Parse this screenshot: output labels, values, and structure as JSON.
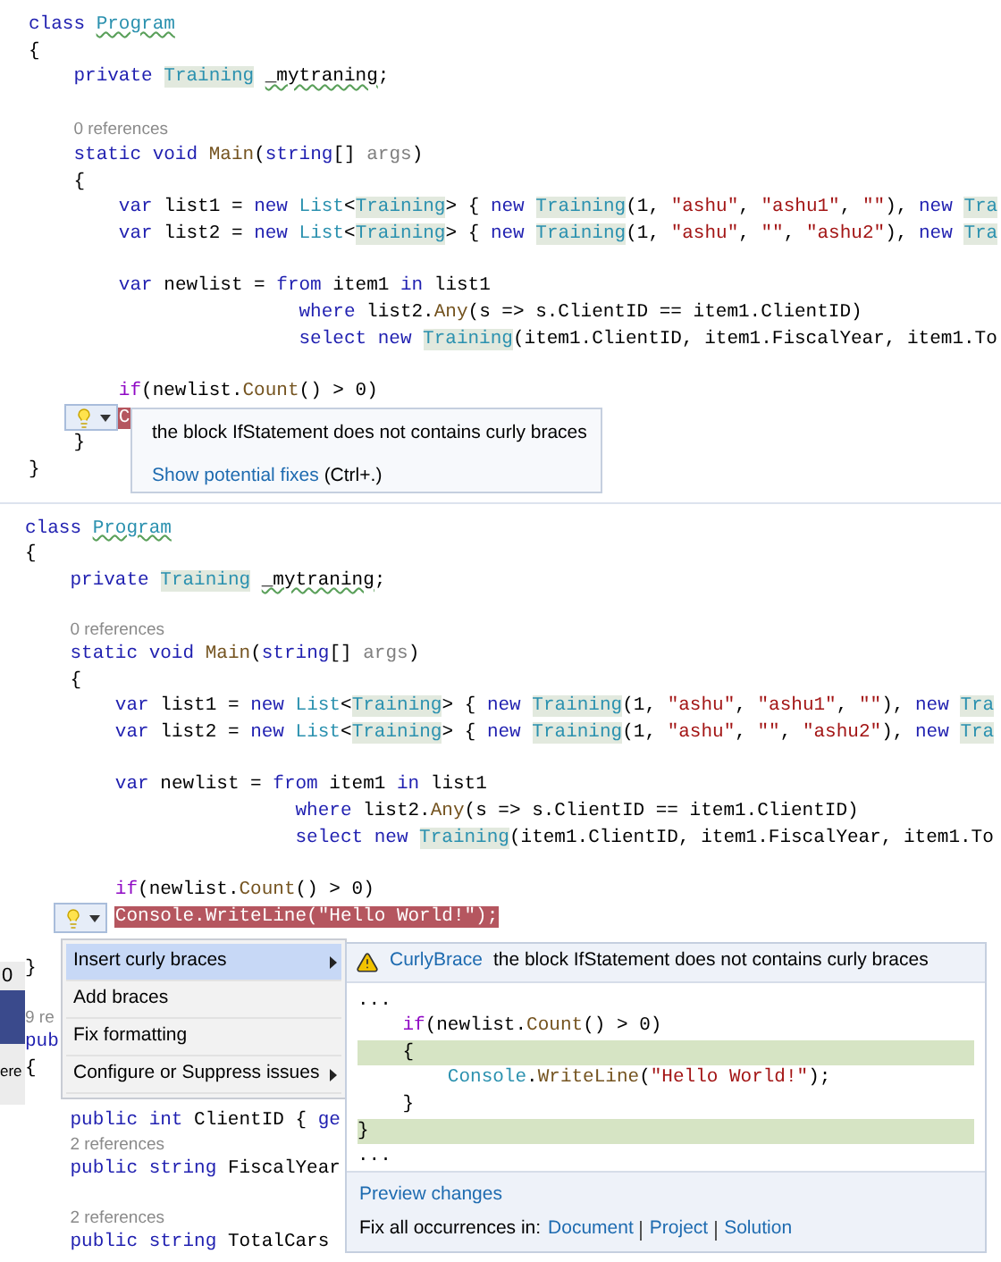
{
  "editors": [
    {
      "lines": [
        {
          "kind": "code",
          "tokens": [
            {
              "text": "class ",
              "kind": "kw"
            },
            {
              "text": "Program",
              "kind": "typeSq"
            }
          ]
        },
        {
          "kind": "code",
          "tokens": [
            {
              "text": "{",
              "kind": "plain"
            }
          ]
        },
        {
          "kind": "code",
          "tokens": [
            {
              "text": "    private ",
              "kind": "kw"
            },
            {
              "text": "Training",
              "kind": "typeHl"
            },
            {
              "text": " _mytraning",
              "kind": "sq"
            },
            {
              "text": ";",
              "kind": "plain"
            }
          ]
        },
        {
          "kind": "blank"
        },
        {
          "kind": "lens",
          "text": "0 references"
        },
        {
          "kind": "code",
          "tokens": [
            {
              "text": "    static void ",
              "kind": "kw"
            },
            {
              "text": "Main",
              "kind": "method"
            },
            {
              "text": "(",
              "kind": "plain"
            },
            {
              "text": "string",
              "kind": "kw"
            },
            {
              "text": "[] ",
              "kind": "plain"
            },
            {
              "text": "args",
              "kind": "param"
            },
            {
              "text": ")",
              "kind": "plain"
            }
          ]
        },
        {
          "kind": "code",
          "tokens": [
            {
              "text": "    {",
              "kind": "plain"
            }
          ]
        },
        {
          "kind": "code",
          "tokens": [
            {
              "text": "        var ",
              "kind": "kw"
            },
            {
              "text": "list1 = ",
              "kind": "plain"
            },
            {
              "text": "new ",
              "kind": "kw"
            },
            {
              "text": "List",
              "kind": "type"
            },
            {
              "text": "<",
              "kind": "plain"
            },
            {
              "text": "Training",
              "kind": "typeHl"
            },
            {
              "text": "> { ",
              "kind": "plain"
            },
            {
              "text": "new ",
              "kind": "kw"
            },
            {
              "text": "Training",
              "kind": "typeHl"
            },
            {
              "text": "(1, ",
              "kind": "plain"
            },
            {
              "text": "\"ashu\"",
              "kind": "str"
            },
            {
              "text": ", ",
              "kind": "plain"
            },
            {
              "text": "\"ashu1\"",
              "kind": "str"
            },
            {
              "text": ", ",
              "kind": "plain"
            },
            {
              "text": "\"\"",
              "kind": "str"
            },
            {
              "text": "), ",
              "kind": "plain"
            },
            {
              "text": "new ",
              "kind": "kw"
            },
            {
              "text": "Tra",
              "kind": "typeHl"
            }
          ]
        },
        {
          "kind": "code",
          "tokens": [
            {
              "text": "        var ",
              "kind": "kw"
            },
            {
              "text": "list2 = ",
              "kind": "plain"
            },
            {
              "text": "new ",
              "kind": "kw"
            },
            {
              "text": "List",
              "kind": "type"
            },
            {
              "text": "<",
              "kind": "plain"
            },
            {
              "text": "Training",
              "kind": "typeHl"
            },
            {
              "text": "> { ",
              "kind": "plain"
            },
            {
              "text": "new ",
              "kind": "kw"
            },
            {
              "text": "Training",
              "kind": "typeHl"
            },
            {
              "text": "(1, ",
              "kind": "plain"
            },
            {
              "text": "\"ashu\"",
              "kind": "str"
            },
            {
              "text": ", ",
              "kind": "plain"
            },
            {
              "text": "\"\"",
              "kind": "str"
            },
            {
              "text": ", ",
              "kind": "plain"
            },
            {
              "text": "\"ashu2\"",
              "kind": "str"
            },
            {
              "text": "), ",
              "kind": "plain"
            },
            {
              "text": "new ",
              "kind": "kw"
            },
            {
              "text": "Tra",
              "kind": "typeHl"
            }
          ]
        },
        {
          "kind": "blank"
        },
        {
          "kind": "code",
          "tokens": [
            {
              "text": "        var ",
              "kind": "kw"
            },
            {
              "text": "newlist = ",
              "kind": "plain"
            },
            {
              "text": "from ",
              "kind": "kw"
            },
            {
              "text": "item1 ",
              "kind": "plain"
            },
            {
              "text": "in ",
              "kind": "kw"
            },
            {
              "text": "list1",
              "kind": "plain"
            }
          ]
        },
        {
          "kind": "code",
          "tokens": [
            {
              "text": "                        where ",
              "kind": "kw"
            },
            {
              "text": "list2.",
              "kind": "plain"
            },
            {
              "text": "Any",
              "kind": "method"
            },
            {
              "text": "(s => s.ClientID == item1.ClientID)",
              "kind": "plain"
            }
          ]
        },
        {
          "kind": "code",
          "tokens": [
            {
              "text": "                        select new ",
              "kind": "kw"
            },
            {
              "text": "Training",
              "kind": "typeHl"
            },
            {
              "text": "(item1.ClientID, item1.FiscalYear, item1.To",
              "kind": "plain"
            }
          ]
        },
        {
          "kind": "blank"
        },
        {
          "kind": "code",
          "tokens": [
            {
              "text": "        if",
              "kind": "ctl"
            },
            {
              "text": "(newlist.",
              "kind": "plain"
            },
            {
              "text": "Count",
              "kind": "method"
            },
            {
              "text": "() > 0)",
              "kind": "plain"
            }
          ]
        },
        {
          "kind": "code",
          "tokens": [
            {
              "text": "        C",
              "kind": "err"
            }
          ]
        },
        {
          "kind": "code",
          "tokens": [
            {
              "text": "    }",
              "kind": "plain"
            }
          ]
        },
        {
          "kind": "code",
          "tokens": [
            {
              "text": "}",
              "kind": "plain"
            }
          ]
        }
      ]
    },
    {
      "lines": [
        {
          "kind": "code",
          "tokens": [
            {
              "text": "class ",
              "kind": "kw"
            },
            {
              "text": "Program",
              "kind": "typeSq"
            }
          ]
        },
        {
          "kind": "code",
          "tokens": [
            {
              "text": "{",
              "kind": "plain"
            }
          ]
        },
        {
          "kind": "code",
          "tokens": [
            {
              "text": "    private ",
              "kind": "kw"
            },
            {
              "text": "Training",
              "kind": "typeHl"
            },
            {
              "text": " _mytraning",
              "kind": "sq"
            },
            {
              "text": ";",
              "kind": "plain"
            }
          ]
        },
        {
          "kind": "blank"
        },
        {
          "kind": "lens",
          "text": "0 references"
        },
        {
          "kind": "code",
          "tokens": [
            {
              "text": "    static void ",
              "kind": "kw"
            },
            {
              "text": "Main",
              "kind": "method"
            },
            {
              "text": "(",
              "kind": "plain"
            },
            {
              "text": "string",
              "kind": "kw"
            },
            {
              "text": "[] ",
              "kind": "plain"
            },
            {
              "text": "args",
              "kind": "param"
            },
            {
              "text": ")",
              "kind": "plain"
            }
          ]
        },
        {
          "kind": "code",
          "tokens": [
            {
              "text": "    {",
              "kind": "plain"
            }
          ]
        },
        {
          "kind": "code",
          "tokens": [
            {
              "text": "        var ",
              "kind": "kw"
            },
            {
              "text": "list1 = ",
              "kind": "plain"
            },
            {
              "text": "new ",
              "kind": "kw"
            },
            {
              "text": "List",
              "kind": "type"
            },
            {
              "text": "<",
              "kind": "plain"
            },
            {
              "text": "Training",
              "kind": "typeHl"
            },
            {
              "text": "> { ",
              "kind": "plain"
            },
            {
              "text": "new ",
              "kind": "kw"
            },
            {
              "text": "Training",
              "kind": "typeHl"
            },
            {
              "text": "(1, ",
              "kind": "plain"
            },
            {
              "text": "\"ashu\"",
              "kind": "str"
            },
            {
              "text": ", ",
              "kind": "plain"
            },
            {
              "text": "\"ashu1\"",
              "kind": "str"
            },
            {
              "text": ", ",
              "kind": "plain"
            },
            {
              "text": "\"\"",
              "kind": "str"
            },
            {
              "text": "), ",
              "kind": "plain"
            },
            {
              "text": "new ",
              "kind": "kw"
            },
            {
              "text": "Tra",
              "kind": "typeHl"
            }
          ]
        },
        {
          "kind": "code",
          "tokens": [
            {
              "text": "        var ",
              "kind": "kw"
            },
            {
              "text": "list2 = ",
              "kind": "plain"
            },
            {
              "text": "new ",
              "kind": "kw"
            },
            {
              "text": "List",
              "kind": "type"
            },
            {
              "text": "<",
              "kind": "plain"
            },
            {
              "text": "Training",
              "kind": "typeHl"
            },
            {
              "text": "> { ",
              "kind": "plain"
            },
            {
              "text": "new ",
              "kind": "kw"
            },
            {
              "text": "Training",
              "kind": "typeHl"
            },
            {
              "text": "(1, ",
              "kind": "plain"
            },
            {
              "text": "\"ashu\"",
              "kind": "str"
            },
            {
              "text": ", ",
              "kind": "plain"
            },
            {
              "text": "\"\"",
              "kind": "str"
            },
            {
              "text": ", ",
              "kind": "plain"
            },
            {
              "text": "\"ashu2\"",
              "kind": "str"
            },
            {
              "text": "), ",
              "kind": "plain"
            },
            {
              "text": "new ",
              "kind": "kw"
            },
            {
              "text": "Tra",
              "kind": "typeHl"
            }
          ]
        },
        {
          "kind": "blank"
        },
        {
          "kind": "code",
          "tokens": [
            {
              "text": "        var ",
              "kind": "kw"
            },
            {
              "text": "newlist = ",
              "kind": "plain"
            },
            {
              "text": "from ",
              "kind": "kw"
            },
            {
              "text": "item1 ",
              "kind": "plain"
            },
            {
              "text": "in ",
              "kind": "kw"
            },
            {
              "text": "list1",
              "kind": "plain"
            }
          ]
        },
        {
          "kind": "code",
          "tokens": [
            {
              "text": "                        where ",
              "kind": "kw"
            },
            {
              "text": "list2.",
              "kind": "plain"
            },
            {
              "text": "Any",
              "kind": "method"
            },
            {
              "text": "(s => s.ClientID == item1.ClientID)",
              "kind": "plain"
            }
          ]
        },
        {
          "kind": "code",
          "tokens": [
            {
              "text": "                        select new ",
              "kind": "kw"
            },
            {
              "text": "Training",
              "kind": "typeHl"
            },
            {
              "text": "(item1.ClientID, item1.FiscalYear, item1.To",
              "kind": "plain"
            }
          ]
        },
        {
          "kind": "blank"
        },
        {
          "kind": "code",
          "tokens": [
            {
              "text": "        if",
              "kind": "ctl"
            },
            {
              "text": "(newlist.",
              "kind": "plain"
            },
            {
              "text": "Count",
              "kind": "method"
            },
            {
              "text": "() > 0)",
              "kind": "plain"
            }
          ]
        },
        {
          "kind": "code",
          "tokens": [
            {
              "text": "        Console.WriteLine(\"Hello World!\");",
              "kind": "err"
            }
          ]
        },
        {
          "kind": "blank"
        },
        {
          "kind": "code",
          "tokens": [
            {
              "text": "}",
              "kind": "plain"
            }
          ]
        },
        {
          "kind": "blank"
        },
        {
          "kind": "lens",
          "text": "9 re"
        },
        {
          "kind": "code",
          "tokens": [
            {
              "text": "pub",
              "kind": "kw"
            }
          ]
        },
        {
          "kind": "code",
          "tokens": [
            {
              "text": "{",
              "kind": "plain"
            }
          ]
        },
        {
          "kind": "blank"
        },
        {
          "kind": "code",
          "tokens": [
            {
              "text": "    public int ",
              "kind": "kw"
            },
            {
              "text": "ClientID { ",
              "kind": "plain"
            },
            {
              "text": "ge",
              "kind": "kw"
            }
          ]
        },
        {
          "kind": "lens",
          "text": "2 references"
        },
        {
          "kind": "code",
          "tokens": [
            {
              "text": "    public string ",
              "kind": "kw"
            },
            {
              "text": "FiscalYear",
              "kind": "plain"
            }
          ]
        },
        {
          "kind": "blank"
        },
        {
          "kind": "lens",
          "text": "2 references"
        },
        {
          "kind": "code",
          "tokens": [
            {
              "text": "    public string ",
              "kind": "kw"
            },
            {
              "text": "TotalCars",
              "kind": "plain"
            }
          ]
        }
      ]
    }
  ],
  "side_panel": {
    "texts": [
      "0",
      "ere"
    ]
  },
  "quick_info": {
    "message": "the block IfStatement does not contains curly braces",
    "link": "Show potential fixes",
    "shortcut": "(Ctrl+.)"
  },
  "actions_menu": {
    "items": [
      {
        "label": "Insert curly braces",
        "selected": true,
        "submenu": true
      },
      {
        "label": "Add braces",
        "selected": false,
        "submenu": false
      },
      {
        "label": "Fix formatting",
        "selected": false,
        "submenu": false
      },
      {
        "label": "Configure or Suppress issues",
        "selected": false,
        "submenu": true
      }
    ]
  },
  "preview": {
    "fix_id": "CurlyBrace",
    "message": "the block IfStatement does not contains curly braces",
    "lines": [
      {
        "added": false,
        "tokens": [
          {
            "text": "...",
            "kind": "plain"
          }
        ]
      },
      {
        "added": false,
        "tokens": [
          {
            "text": "    if",
            "kind": "ctl"
          },
          {
            "text": "(newlist.",
            "kind": "plain"
          },
          {
            "text": "Count",
            "kind": "method"
          },
          {
            "text": "() > 0)",
            "kind": "plain"
          }
        ]
      },
      {
        "added": true,
        "tokens": [
          {
            "text": "    {",
            "kind": "plain"
          }
        ]
      },
      {
        "added": false,
        "tokens": [
          {
            "text": "        Console",
            "kind": "type"
          },
          {
            "text": ".",
            "kind": "plain"
          },
          {
            "text": "WriteLine",
            "kind": "method"
          },
          {
            "text": "(",
            "kind": "plain"
          },
          {
            "text": "\"Hello World!\"",
            "kind": "str"
          },
          {
            "text": ");",
            "kind": "plain"
          }
        ]
      },
      {
        "added": false,
        "tokens": [
          {
            "text": "    }",
            "kind": "plain"
          }
        ]
      },
      {
        "added": true,
        "tokens": [
          {
            "text": "}",
            "kind": "plain"
          }
        ]
      },
      {
        "added": false,
        "tokens": [
          {
            "text": "...",
            "kind": "plain"
          }
        ]
      }
    ],
    "preview_link": "Preview changes",
    "fix_all_label": "Fix all occurrences in:",
    "scopes": [
      "Document",
      "Project",
      "Solution"
    ]
  }
}
